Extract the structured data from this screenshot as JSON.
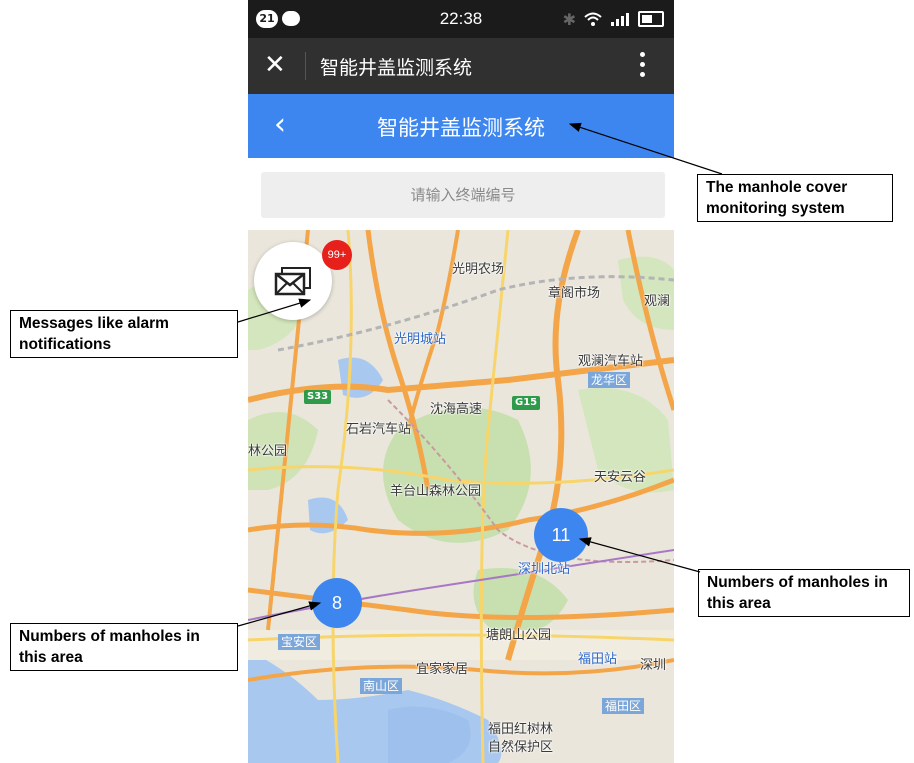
{
  "status_bar": {
    "notification_count": "21",
    "time": "22:38",
    "icons": [
      "chat-bubble-icon",
      "bluetooth-icon",
      "wifi-icon",
      "signal-icon",
      "battery-icon"
    ]
  },
  "title_bar": {
    "close_icon": "close-icon",
    "title": "智能井盖监测系统",
    "more_icon": "more-vertical-icon"
  },
  "app_header": {
    "back_icon": "back-chevron-icon",
    "title": "智能井盖监测系统",
    "color": "#3d86f0"
  },
  "search": {
    "placeholder": "请输入终端编号"
  },
  "map": {
    "message_button": {
      "icon": "mail-icon",
      "badge": "99+"
    },
    "clusters": [
      {
        "count": "11"
      },
      {
        "count": "8"
      }
    ],
    "labels": [
      "光明农场",
      "章阁市场",
      "观澜",
      "光明城站",
      "观澜汽车站",
      "龙华区",
      "沈海高速",
      "石岩汽车站",
      "林公园",
      "羊台山森林公园",
      "天安云谷",
      "深圳北站",
      "塘朗山公园",
      "宝安区",
      "宜家家居",
      "福田站",
      "深圳",
      "南山区",
      "福田区",
      "福田红树林",
      "自然保护区"
    ],
    "shields": [
      "S33",
      "G15"
    ]
  },
  "annotations": {
    "system": "The manhole cover monitoring system",
    "messages": "Messages like alarm notifications",
    "cluster_right": "Numbers of manholes in this area",
    "cluster_left": "Numbers of manholes in this area"
  }
}
